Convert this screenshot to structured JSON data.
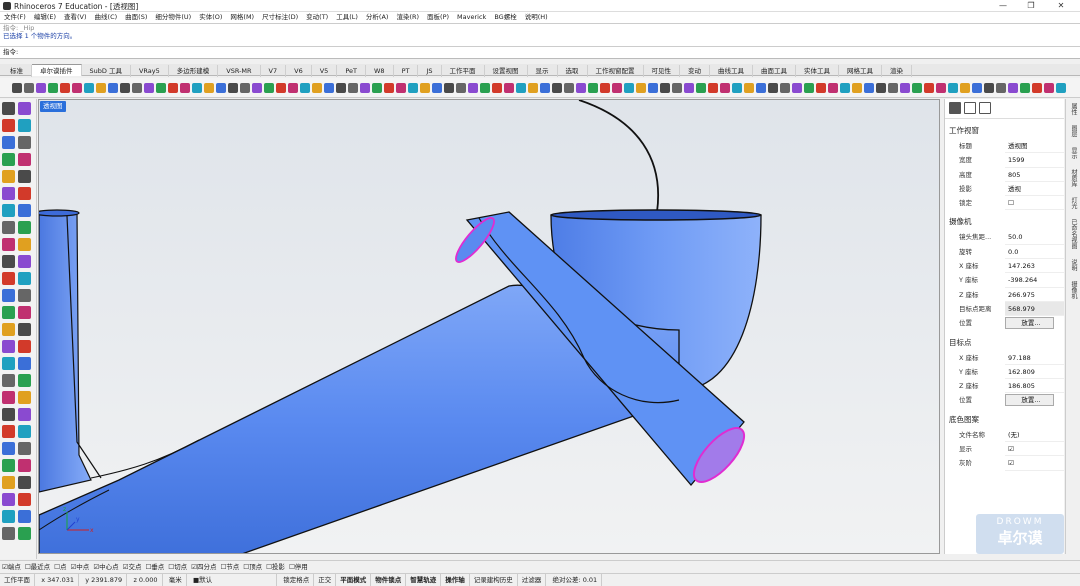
{
  "window": {
    "title": "Rhinoceros 7 Education - [透视图]",
    "controls": [
      "—",
      "❐",
      "✕"
    ]
  },
  "menu": [
    "文件(F)",
    "编辑(E)",
    "查看(V)",
    "曲线(C)",
    "曲面(S)",
    "细分物件(U)",
    "实体(O)",
    "网格(M)",
    "尺寸标注(D)",
    "变动(T)",
    "工具(L)",
    "分析(A)",
    "渲染(R)",
    "面板(P)",
    "Maverick",
    "BG螺栓",
    "说明(H)"
  ],
  "command": {
    "history": [
      "指令: _Hip",
      "已选择 1 个物件的方向。"
    ],
    "prompt": "指令:"
  },
  "tabs": [
    "标准",
    "卓尔谟插件",
    "SubD 工具",
    "VRay5",
    "多边形建模",
    "VSR-MR",
    "V7",
    "V6",
    "V5",
    "PeT",
    "W8",
    "PT",
    "JS",
    "工作平面",
    "设置视图",
    "显示",
    "选取",
    "工作视窗配置",
    "可见性",
    "变动",
    "曲线工具",
    "曲面工具",
    "实体工具",
    "网格工具",
    "渲染"
  ],
  "active_tab": "卓尔谟插件",
  "viewport": {
    "title": "透视图",
    "axis_x": "x",
    "axis_y": "y",
    "axis_z": "z"
  },
  "panel": {
    "section_viewport": "工作视窗",
    "rows_viewport": [
      {
        "k": "标题",
        "v": "透视图"
      },
      {
        "k": "宽度",
        "v": "1599"
      },
      {
        "k": "高度",
        "v": "805"
      },
      {
        "k": "投影",
        "v": "透视"
      },
      {
        "k": "锁定",
        "v": "☐"
      }
    ],
    "section_camera": "摄像机",
    "rows_camera": [
      {
        "k": "镜头焦距...",
        "v": "50.0"
      },
      {
        "k": "旋转",
        "v": "0.0"
      },
      {
        "k": "X 座标",
        "v": "147.263"
      },
      {
        "k": "Y 座标",
        "v": "-398.264"
      },
      {
        "k": "Z 座标",
        "v": "266.975"
      },
      {
        "k": "目标点距离",
        "v": "568.979"
      },
      {
        "k": "位置",
        "v": "放置..."
      }
    ],
    "section_target": "目标点",
    "rows_target": [
      {
        "k": "X 座标",
        "v": "97.188"
      },
      {
        "k": "Y 座标",
        "v": "162.809"
      },
      {
        "k": "Z 座标",
        "v": "186.805"
      },
      {
        "k": "位置",
        "v": "放置..."
      }
    ],
    "section_bg": "底色图案",
    "rows_bg": [
      {
        "k": "文件名称",
        "v": "(无)"
      },
      {
        "k": "显示",
        "v": "☑"
      },
      {
        "k": "灰阶",
        "v": "☑"
      }
    ]
  },
  "right_rail": [
    "属性",
    "图层",
    "显示",
    "材质库",
    "灯光",
    "已命名视图",
    "说明",
    "摄像机"
  ],
  "snaps": [
    "☑端点",
    "☐最近点",
    "☐点",
    "☑中点",
    "☑中心点",
    "☑交点",
    "☐垂点",
    "☐切点",
    "☑四分点",
    "☐节点",
    "☐顶点",
    "☐投影",
    "☐停用"
  ],
  "status": {
    "cplane": "工作平面",
    "x": "x 347.031",
    "y": "y 2391.879",
    "z": "z 0.000",
    "unit": "毫米",
    "layer": "■默认",
    "toggles": [
      "锁定格点",
      "正交",
      "平面模式",
      "物件锁点",
      "智慧轨迹",
      "操作轴",
      "记录建构历史",
      "过滤器"
    ],
    "tolerance": "绝对公差: 0.01"
  },
  "watermark": {
    "line1": "DROWM",
    "line2": "卓尔谟"
  },
  "colors": {
    "pipe": "#5b8cf0",
    "edge": "#111111",
    "seam": "#e02cd2",
    "viewport_title": "#2a6fdb"
  }
}
